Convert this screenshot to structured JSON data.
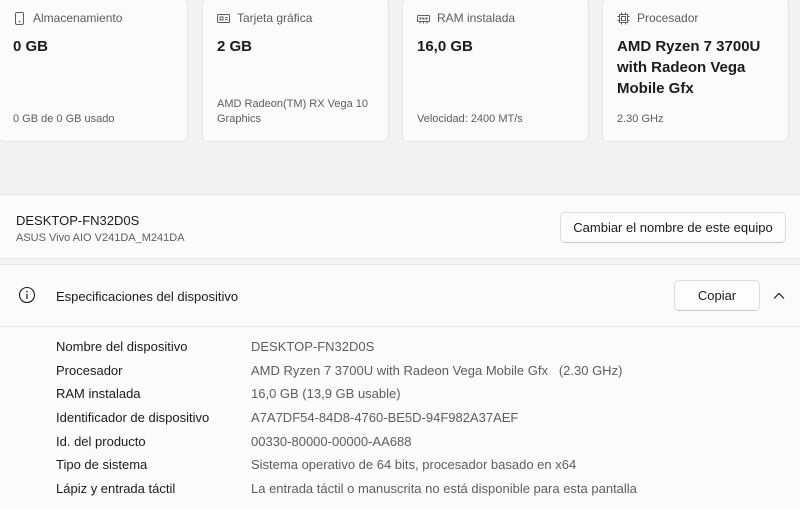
{
  "cards": [
    {
      "id": "storage",
      "icon": "storage-drive-icon",
      "label": "Almacenamiento",
      "value": "0 GB",
      "sub": "0 GB de 0 GB usado"
    },
    {
      "id": "gpu",
      "icon": "graphics-card-icon",
      "label": "Tarjeta gráfica",
      "value": "2 GB",
      "sub": "AMD Radeon(TM) RX Vega 10 Graphics"
    },
    {
      "id": "ram",
      "icon": "ram-icon",
      "label": "RAM instalada",
      "value": "16,0 GB",
      "sub": "Velocidad: 2400 MT/s"
    },
    {
      "id": "cpu",
      "icon": "processor-icon",
      "label": "Procesador",
      "value": "AMD Ryzen 7 3700U with Radeon Vega Mobile Gfx",
      "sub": "2.30 GHz"
    }
  ],
  "device": {
    "name": "DESKTOP-FN32D0S",
    "model": "ASUS Vivo AIO V241DA_M241DA",
    "rename_label": "Cambiar el nombre de este equipo"
  },
  "specs": {
    "title": "Especificaciones del dispositivo",
    "copy_label": "Copiar",
    "rows": [
      {
        "key": "Nombre del dispositivo",
        "value": "DESKTOP-FN32D0S"
      },
      {
        "key": "Procesador",
        "value": "AMD Ryzen 7 3700U with Radeon Vega Mobile Gfx   (2.30 GHz)"
      },
      {
        "key": "RAM instalada",
        "value": "16,0 GB (13,9 GB usable)"
      },
      {
        "key": "Identificador de dispositivo",
        "value": "A7A7DF54-84D8-4760-BE5D-94F982A37AEF"
      },
      {
        "key": "Id. del producto",
        "value": "00330-80000-00000-AA688"
      },
      {
        "key": "Tipo de sistema",
        "value": "Sistema operativo de 64 bits, procesador basado en x64"
      },
      {
        "key": "Lápiz y entrada táctil",
        "value": "La entrada táctil o manuscrita no está disponible para esta pantalla"
      }
    ]
  }
}
